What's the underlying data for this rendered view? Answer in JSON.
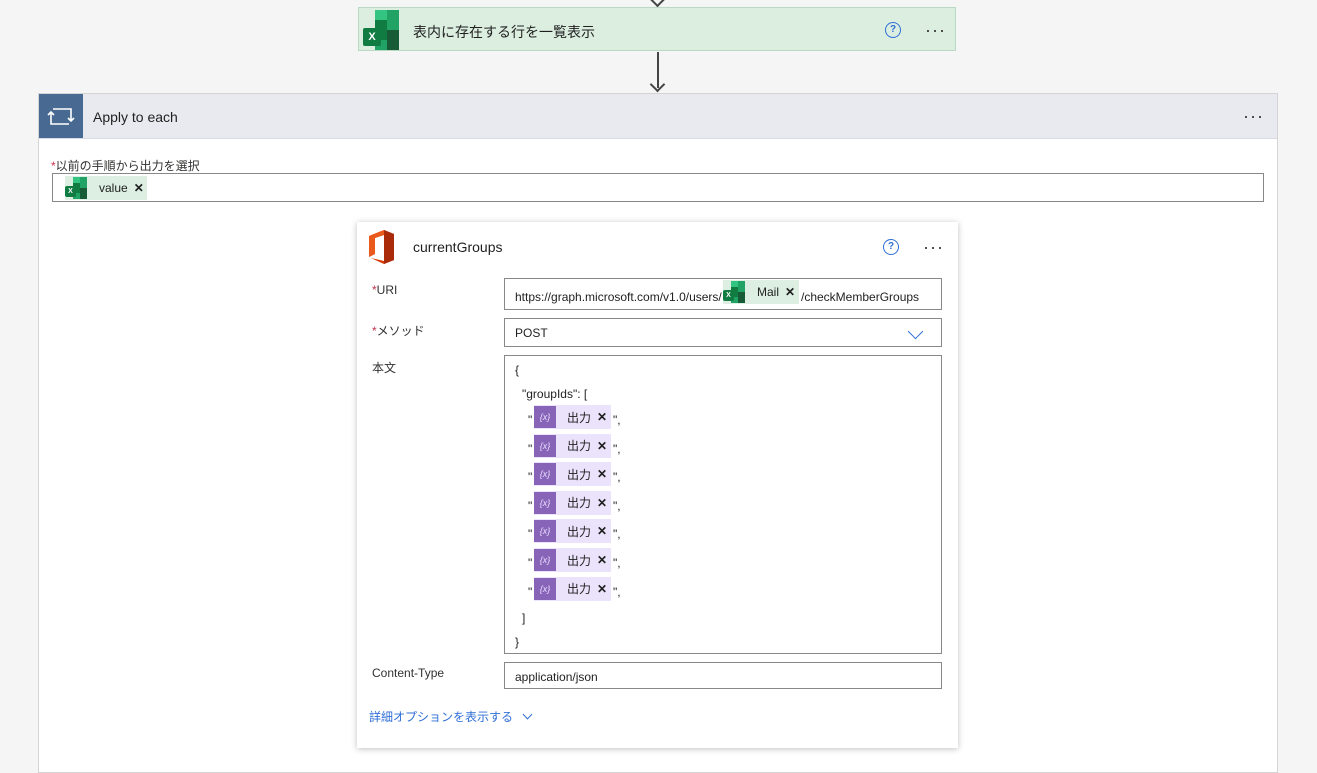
{
  "top_action": {
    "title": "表内に存在する行を一覧表示"
  },
  "apply_to_each": {
    "title": "Apply to each",
    "select_label": "以前の手順から出力を選択",
    "required_mark": "*",
    "token_label": "value",
    "remove_glyph": "✕"
  },
  "current_groups": {
    "title": "currentGroups",
    "uri": {
      "label": "URI",
      "prefix": "https://graph.microsoft.com/v1.0/users/",
      "token": "Mail",
      "suffix": "/checkMemberGroups"
    },
    "method": {
      "label": "メソッド",
      "value": "POST"
    },
    "body": {
      "label": "本文",
      "open_brace": "{",
      "group_ids_line": "\"groupIds\": [",
      "token_label": "出力",
      "token_icon": "{x}",
      "quote_open": "\"",
      "quote_close": "\",",
      "close_bracket": "]",
      "close_brace": "}",
      "rows": 7
    },
    "content_type": {
      "label": "Content-Type",
      "value": "application/json"
    },
    "advanced_link": "詳細オプションを表示する"
  },
  "colors": {
    "excel_green": "#107c41",
    "loop_blue": "#486991",
    "expression_purple": "#8764b8",
    "link_blue": "#2f6fd6",
    "office_red": "#d83b01"
  }
}
